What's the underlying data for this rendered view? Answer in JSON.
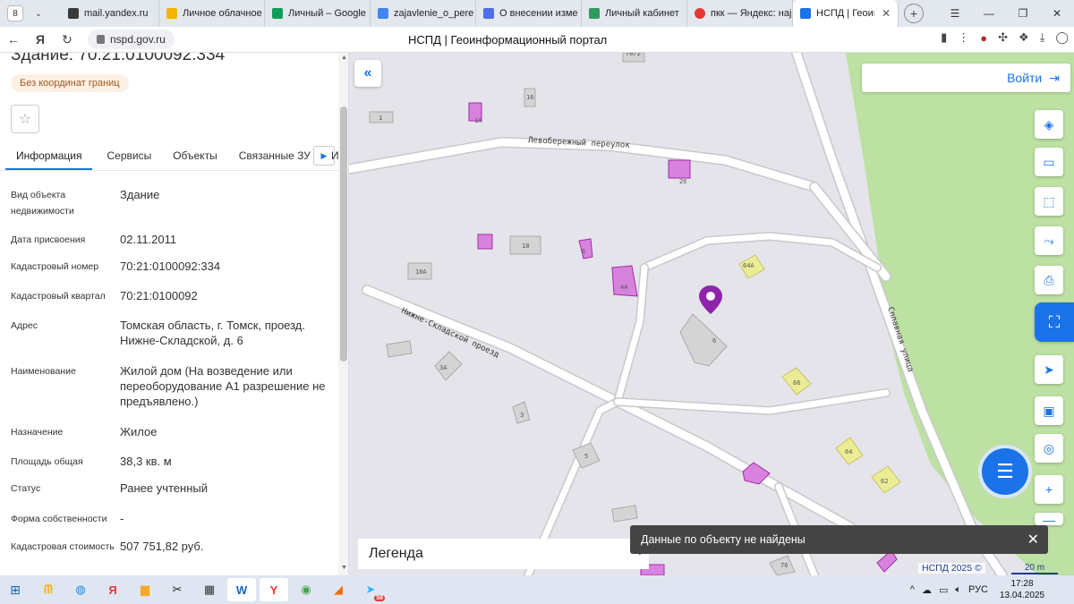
{
  "browser": {
    "tab_count": "8",
    "tabs": [
      {
        "label": "mail.yandex.ru",
        "color": "#3a3a3a"
      },
      {
        "label": "Личное облачное",
        "color": "#f4b400"
      },
      {
        "label": "Личный – Google",
        "color": "#0f9d58"
      },
      {
        "label": "zajavlenie_o_pere",
        "color": "#4285f4"
      },
      {
        "label": "О внесении изме",
        "color": "#4f6fe8"
      },
      {
        "label": "Личный кабинет",
        "color": "#2e9a5c"
      },
      {
        "label": "пкк — Яндекс: нај",
        "color": "#e53935"
      },
      {
        "label": "НСПД | Геоинф",
        "color": "#1a73e8"
      }
    ],
    "url": "nspd.gov.ru",
    "page_title": "НСПД | Геоинформационный портал"
  },
  "panel": {
    "title": "Здание: 70:21:0100092:334",
    "chip": "Без координат границ",
    "tabs": [
      "Информация",
      "Сервисы",
      "Объекты",
      "Связанные ЗУ"
    ],
    "more_tab_partial": "И",
    "properties": [
      {
        "label": "Вид объекта недвижимости",
        "value": "Здание"
      },
      {
        "label": "Дата присвоения",
        "value": "02.11.2011"
      },
      {
        "label": "Кадастровый номер",
        "value": "70:21:0100092:334"
      },
      {
        "label": "Кадастровый квартал",
        "value": "70:21:0100092"
      },
      {
        "label": "Адрес",
        "value": "Томская область, г. Томск, проезд. Нижне-Складской, д. 6"
      },
      {
        "label": "Наименование",
        "value": "Жилой дом (На возведение или переоборудование А1 разрешение не предъявлено.)"
      },
      {
        "label": "Назначение",
        "value": "Жилое"
      },
      {
        "label": "Площадь общая",
        "value": "38,3 кв. м"
      },
      {
        "label": "Статус",
        "value": "Ранее учтенный"
      },
      {
        "label": "Форма собственности",
        "value": "-"
      },
      {
        "label": "Кадастровая стоимость",
        "value": "507 751,82 руб."
      }
    ]
  },
  "map": {
    "login_label": "Войти",
    "legend_label": "Легенда",
    "toast_text": "Данные по объекту не найдены",
    "copyright": "НСПД 2025 ©",
    "scale": "20 m",
    "streets": {
      "levoberezhny": "Левобережный переулок",
      "nizhne": "Нижне-Складской проезд",
      "splavnaya": "Сплавная улица"
    },
    "labels": {
      "b1": "1",
      "b16": "16",
      "b1a": "1А",
      "b2b": "2б",
      "b18": "18",
      "b18a": "18А",
      "b4a": "4А",
      "b6": "6",
      "b64a": "64А",
      "b3a": "3А",
      "b3": "3",
      "b5": "5",
      "b66": "66",
      "b64": "64",
      "b62": "62",
      "b76": "76",
      "b6a": "6А",
      "b70_2": "70/2",
      "b6s": "6"
    }
  },
  "taskbar": {
    "lang": "РУС",
    "time": "17:28",
    "date": "13.04.2025",
    "telegram_badge": "58"
  }
}
